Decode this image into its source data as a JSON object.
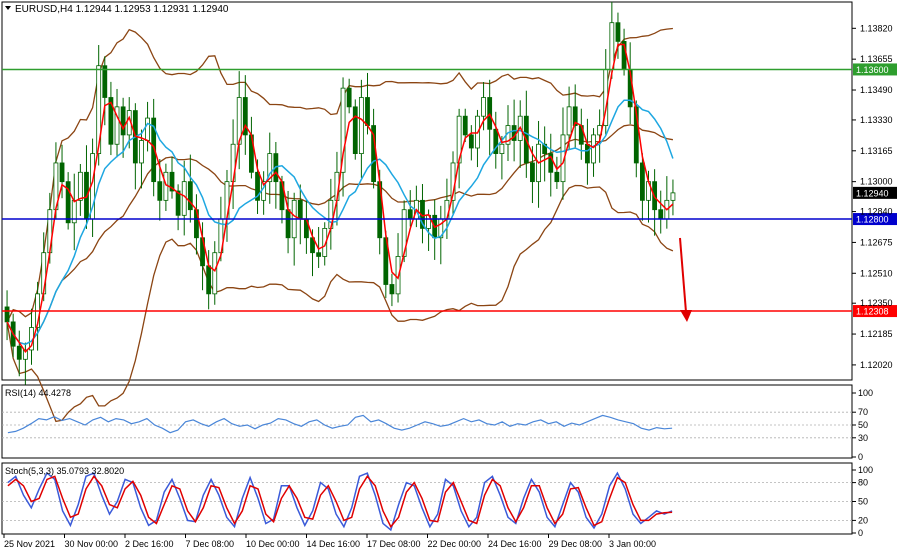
{
  "window": {
    "symbol_header": "EURUSD,H4  1.12944 1.12953 1.12931 1.12940"
  },
  "colors": {
    "candle": "#006400",
    "bollinger": "#8B4513",
    "ma_fast": "#FF0000",
    "ma_slow": "#1EA7E1",
    "resistance_line": "#2E9E2E",
    "support_line": "#0000CD",
    "target_line": "#FF0000",
    "rsi_line": "#4A86D8",
    "stoch_main": "#3B5BD9",
    "stoch_signal": "#E00000",
    "arrow": "#E00000"
  },
  "chart_data": [
    {
      "type": "candlestick",
      "name": "main",
      "ylim": [
        1.1195,
        1.1395
      ],
      "y_ticks": [
        "1.13820",
        "1.13655",
        "1.13490",
        "1.13330",
        "1.13165",
        "1.13000",
        "1.12840",
        "1.12675",
        "1.12510",
        "1.12350",
        "1.12185",
        "1.12020"
      ],
      "x_ticks": [
        "25 Nov 2021",
        "30 Nov 00:00",
        "2 Dec 16:00",
        "7 Dec 08:00",
        "10 Dec 00:00",
        "14 Dec 16:00",
        "17 Dec 08:00",
        "22 Dec 00:00",
        "24 Dec 16:00",
        "29 Dec 08:00",
        "3 Jan 00:00"
      ],
      "price_lines": [
        {
          "label": "1.13600",
          "value": 1.136,
          "color": "#2E9E2E"
        },
        {
          "label": "1.12800",
          "value": 1.128,
          "color": "#0000CD"
        },
        {
          "label": "1.12308",
          "value": 1.12308,
          "color": "#FF0000"
        }
      ],
      "current_price": {
        "label": "1.12940",
        "value": 1.1294
      },
      "closes": [
        1.1225,
        1.1212,
        1.1205,
        1.121,
        1.1222,
        1.124,
        1.1262,
        1.1285,
        1.131,
        1.13,
        1.1278,
        1.129,
        1.1305,
        1.128,
        1.1315,
        1.1362,
        1.1345,
        1.132,
        1.134,
        1.1325,
        1.1338,
        1.131,
        1.1322,
        1.1334,
        1.13,
        1.129,
        1.1305,
        1.1295,
        1.1282,
        1.13,
        1.1285,
        1.127,
        1.1255,
        1.124,
        1.1262,
        1.128,
        1.13,
        1.132,
        1.1345,
        1.1325,
        1.1305,
        1.129,
        1.13,
        1.1315,
        1.13,
        1.1285,
        1.127,
        1.129,
        1.128,
        1.127,
        1.1262,
        1.126,
        1.1275,
        1.129,
        1.1305,
        1.135,
        1.134,
        1.1315,
        1.1345,
        1.133,
        1.13,
        1.127,
        1.1245,
        1.124,
        1.126,
        1.1285,
        1.128,
        1.129,
        1.1275,
        1.1282,
        1.127,
        1.128,
        1.129,
        1.131,
        1.1335,
        1.1325,
        1.1318,
        1.1335,
        1.1345,
        1.1328,
        1.1315,
        1.132,
        1.133,
        1.1322,
        1.1335,
        1.131,
        1.13,
        1.132,
        1.1315,
        1.1305,
        1.13,
        1.1325,
        1.134,
        1.133,
        1.132,
        1.131,
        1.1325,
        1.133,
        1.136,
        1.1385,
        1.1375,
        1.136,
        1.134,
        1.131,
        1.129,
        1.13,
        1.1285,
        1.128,
        1.129,
        1.1294
      ]
    },
    {
      "type": "line",
      "name": "rsi",
      "header": "RSI(14) 44.4278",
      "ylim": [
        0,
        100
      ],
      "y_ticks": [
        "100",
        "70",
        "50",
        "30",
        "0"
      ],
      "levels": [
        70,
        50,
        30
      ],
      "values": [
        38,
        40,
        45,
        52,
        60,
        58,
        63,
        57,
        60,
        55,
        50,
        58,
        62,
        55,
        60,
        58,
        52,
        55,
        60,
        50,
        45,
        38,
        42,
        55,
        58,
        52,
        48,
        55,
        60,
        52,
        48,
        50,
        44,
        50,
        53,
        60,
        58,
        52,
        48,
        55,
        58,
        50,
        45,
        48,
        50,
        62,
        65,
        55,
        58,
        52,
        45,
        42,
        45,
        50,
        55,
        52,
        48,
        50,
        55,
        60,
        55,
        58,
        52,
        50,
        55,
        48,
        52,
        50,
        55,
        58,
        52,
        55,
        48,
        53,
        50,
        55,
        60,
        65,
        62,
        58,
        55,
        52,
        45,
        42,
        46,
        44,
        45
      ]
    },
    {
      "type": "line",
      "name": "stochastic",
      "header": "Stoch(5,3,3) 35.0793 32.8020",
      "ylim": [
        0,
        100
      ],
      "y_ticks": [
        "100",
        "80",
        "50",
        "20",
        "0"
      ],
      "levels": [
        80,
        50,
        20
      ],
      "series": [
        {
          "values": [
            80,
            90,
            60,
            40,
            70,
            95,
            85,
            35,
            12,
            45,
            90,
            95,
            60,
            30,
            50,
            85,
            80,
            40,
            12,
            20,
            65,
            85,
            55,
            20,
            18,
            60,
            85,
            60,
            25,
            10,
            55,
            88,
            55,
            15,
            22,
            75,
            75,
            40,
            12,
            35,
            80,
            70,
            30,
            10,
            40,
            90,
            95,
            60,
            15,
            5,
            45,
            80,
            75,
            40,
            10,
            30,
            85,
            75,
            35,
            10,
            25,
            80,
            90,
            60,
            25,
            15,
            55,
            85,
            65,
            25,
            10,
            45,
            80,
            65,
            25,
            8,
            30,
            75,
            95,
            70,
            30,
            15,
            25,
            35,
            30,
            35
          ]
        },
        {
          "values": [
            75,
            85,
            75,
            50,
            55,
            85,
            90,
            55,
            25,
            30,
            70,
            90,
            75,
            45,
            40,
            70,
            82,
            60,
            25,
            15,
            45,
            75,
            70,
            35,
            18,
            40,
            75,
            72,
            40,
            15,
            35,
            75,
            70,
            30,
            18,
            55,
            75,
            55,
            25,
            22,
            60,
            75,
            50,
            20,
            25,
            70,
            90,
            75,
            35,
            10,
            25,
            65,
            80,
            55,
            20,
            18,
            65,
            80,
            50,
            20,
            15,
            60,
            85,
            75,
            40,
            18,
            40,
            75,
            75,
            40,
            15,
            30,
            70,
            72,
            40,
            12,
            18,
            55,
            88,
            80,
            45,
            20,
            20,
            30,
            32,
            33
          ]
        }
      ]
    }
  ]
}
